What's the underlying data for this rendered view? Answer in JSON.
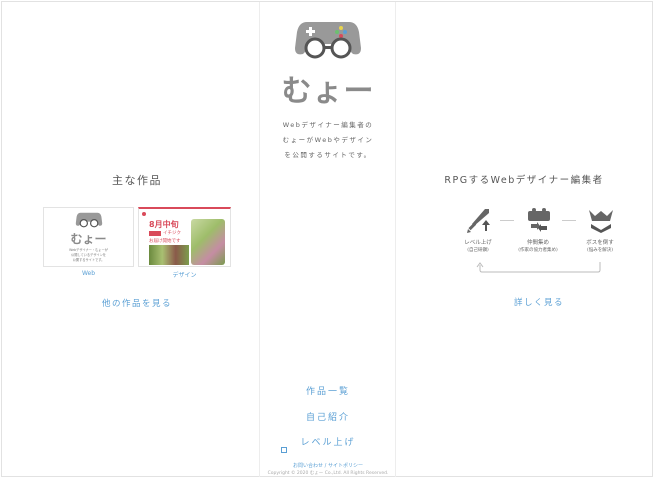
{
  "site": {
    "logo_text": "むょー",
    "description": [
      "Webデザイナー編集者の",
      "むょーがWebやデザイン",
      "を公開するサイトです。"
    ]
  },
  "works": {
    "title": "主な作品",
    "items": [
      {
        "caption": "Web",
        "mini_logo": "むょー",
        "mini_text": [
          "Webデザイナー・むょーが",
          "公開しているデザインを",
          "公開するサイトです。"
        ]
      },
      {
        "caption": "デザイン",
        "headline": "8月中旬",
        "badge": "イチジク",
        "subline": "お届け開始です"
      }
    ],
    "more_link": "他の作品を見る"
  },
  "profile": {
    "title": "RPGするWebデザイナー編集者",
    "steps": [
      {
        "icon": "sword-up-icon",
        "label": "レベル上げ",
        "sub": "(自己研鑽)"
      },
      {
        "icon": "party-icon",
        "label": "仲間集め",
        "sub": "(作家の協力者集め)"
      },
      {
        "icon": "boss-icon",
        "label": "ボスを倒す",
        "sub": "(悩みを解決)"
      }
    ],
    "more_link": "詳しく見る"
  },
  "nav": {
    "items": [
      "作品一覧",
      "自己紹介",
      "レベル上げ"
    ]
  },
  "footer": {
    "contact": "お問い合わせ",
    "separator": "/",
    "sitemap": "サイトポリシー",
    "copyright": "Copyright © 2020 むょー Co.,Ltd. All Rights Reserved."
  },
  "colors": {
    "accent": "#5a9fd4",
    "logo": "#8a8a8a",
    "red": "#d94a5a"
  }
}
